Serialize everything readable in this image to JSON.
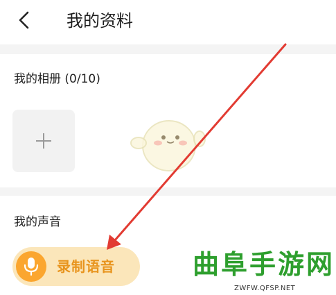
{
  "header": {
    "title": "我的资料",
    "back_icon": "chevron-left-icon"
  },
  "album": {
    "label": "我的相册 (0/10)",
    "add_icon": "plus-icon"
  },
  "voice": {
    "label": "我的声音",
    "record_label": "录制语音",
    "mic_icon": "microphone-icon"
  },
  "watermark": {
    "text": "曲阜手游网",
    "url": "ZWFW.QFSP.NET"
  },
  "colors": {
    "accent_orange": "#fba62f",
    "record_bg": "#fbe6ba",
    "record_text": "#e8941d",
    "annotation_red": "#e23b32",
    "watermark_green": "#2e9f2e",
    "divider": "#f4f4f4"
  }
}
